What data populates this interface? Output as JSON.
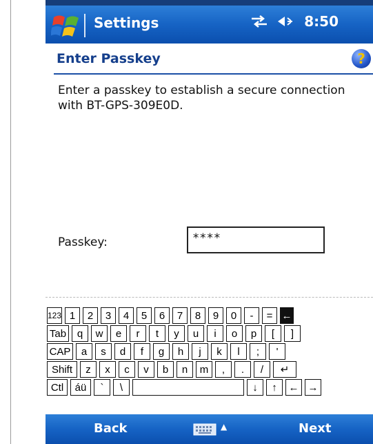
{
  "titlebar": {
    "title": "Settings",
    "time": "8:50",
    "icons": [
      "windows-start-icon",
      "connectivity-icon",
      "volume-icon"
    ]
  },
  "heading": {
    "title": "Enter Passkey",
    "help_label": "?"
  },
  "description": "Enter a passkey to establish a secure connection with BT-GPS-309E0D.",
  "passkey": {
    "label": "Passkey:",
    "value": "****"
  },
  "keyboard": {
    "rows": [
      [
        "123",
        "1",
        "2",
        "3",
        "4",
        "5",
        "6",
        "7",
        "8",
        "9",
        "0",
        "-",
        "=",
        "←"
      ],
      [
        "Tab",
        "q",
        "w",
        "e",
        "r",
        "t",
        "y",
        "u",
        "i",
        "o",
        "p",
        "[",
        "]"
      ],
      [
        "CAP",
        "a",
        "s",
        "d",
        "f",
        "g",
        "h",
        "j",
        "k",
        "l",
        ";",
        "'"
      ],
      [
        "Shift",
        "z",
        "x",
        "c",
        "v",
        "b",
        "n",
        "m",
        ",",
        ".",
        "/",
        "↵"
      ],
      [
        "Ctl",
        "áü",
        "`",
        "\\",
        "",
        "↓",
        "↑",
        "←",
        "→"
      ]
    ]
  },
  "softkeys": {
    "left": "Back",
    "right": "Next",
    "input_arrow": "▲"
  },
  "colors": {
    "bar_blue": "#1663c4",
    "heading_blue": "#153f8c"
  }
}
